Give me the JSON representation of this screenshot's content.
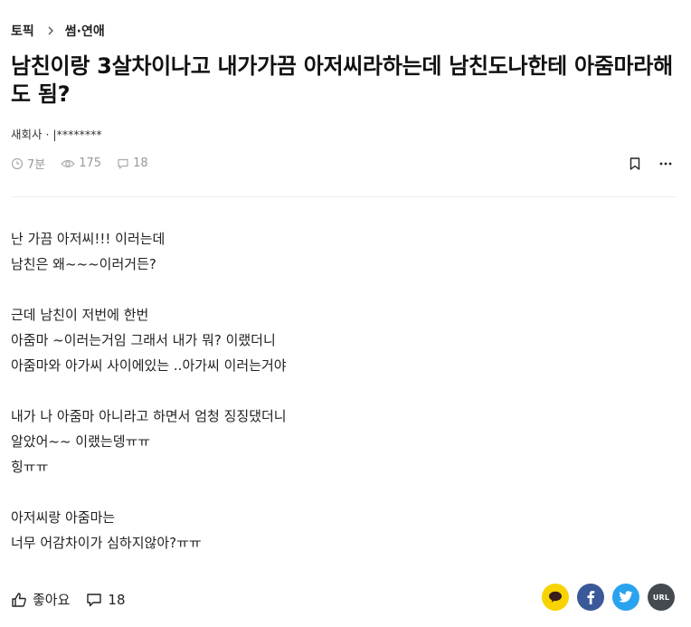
{
  "breadcrumb": {
    "topic": "토픽",
    "category": "썸·연애"
  },
  "post": {
    "title": "남친이랑 3살차이나고 내가가끔 아저씨라하는데 남친도나한테 아줌마라해도 됨?",
    "author": "새회사 · |********",
    "time_ago": "7분",
    "views": "175",
    "comments": "18",
    "body_lines": [
      "난 가끔 아저씨!!! 이러는데",
      "남친은 왜~~~이러거든?",
      "",
      "근데 남친이 저번에 한번",
      "아줌마 ~이러는거임 그래서 내가 뭐? 이랬더니",
      "아줌마와 아가씨 사이에있는 ..아가씨 이러는거야",
      "",
      "내가 나 아줌마 아니라고 하면서 엄청 징징댔더니",
      "알았어~~ 이랬는뎅ㅠㅠ",
      "힝ㅠㅠ",
      "",
      "아저씨랑 아줌마는",
      "너무 어감차이가 심하지않아?ㅠㅠ"
    ]
  },
  "footer": {
    "like_label": "좋아요",
    "comment_count": "18",
    "url_label": "URL"
  },
  "icons": {
    "clock": "clock-icon",
    "eye": "eye-icon",
    "comment": "comment-icon",
    "bookmark": "bookmark-icon",
    "more": "more-icon",
    "thumbs_up": "thumbs-up-icon",
    "kakao": "kakao-icon",
    "facebook": "facebook-icon",
    "twitter": "twitter-icon"
  },
  "colors": {
    "kakao": "#f7d300",
    "facebook": "#3b5998",
    "twitter": "#2aa3ef",
    "url": "#444a4f",
    "meta_gray": "#999999"
  }
}
